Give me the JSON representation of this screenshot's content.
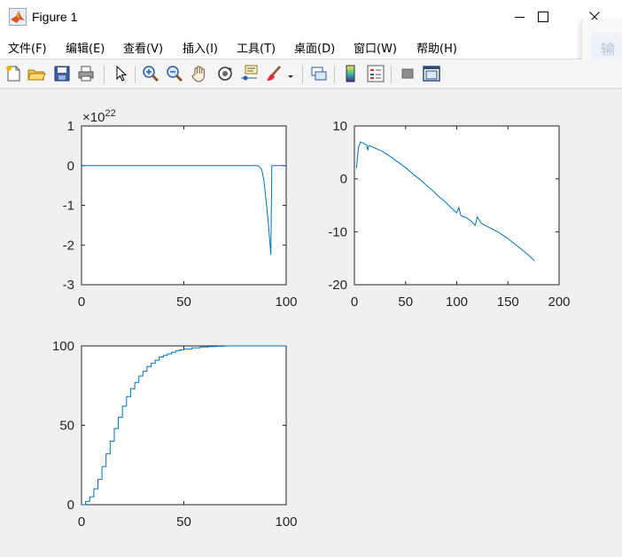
{
  "window": {
    "title": "Figure 1",
    "icon": "matlab-icon",
    "controls": [
      "minimize-icon",
      "maximize-icon",
      "close-icon"
    ]
  },
  "menu": [
    "文件(F)",
    "编辑(E)",
    "查看(V)",
    "插入(I)",
    "工具(T)",
    "桌面(D)",
    "窗口(W)",
    "帮助(H)"
  ],
  "toolbar": [
    "new-figure-icon",
    "open-file-icon",
    "save-icon",
    "print-icon",
    "select-arrow-icon",
    "zoom-in-icon",
    "zoom-out-icon",
    "pan-hand-icon",
    "rotate-3d-icon",
    "data-cursor-icon",
    "brush-icon",
    "brush-dropdown-icon",
    "link-plot-icon",
    "colorbar-icon",
    "legend-icon",
    "hide-plot-tools-icon",
    "show-plot-tools-icon"
  ],
  "ime": {
    "text": "输"
  },
  "colors": {
    "line": "#0072bd",
    "axes": "#262626",
    "figure": "#f0f0f0"
  },
  "chart_data": [
    {
      "type": "line",
      "title": "",
      "xlabel": "",
      "ylabel": "",
      "exponent_label": {
        "base": "×10",
        "power": "22"
      },
      "xlim": [
        0,
        100
      ],
      "ylim": [
        -3,
        1
      ],
      "xticks": [
        0,
        50,
        100
      ],
      "yticks": [
        1,
        0,
        -1,
        -2,
        -3
      ],
      "grid": false,
      "series": [
        {
          "x": [
            0,
            86,
            87,
            88,
            88.5,
            89,
            89.5,
            90,
            90.5,
            91,
            91.5,
            92,
            92.5,
            93,
            93.5,
            94,
            94.5,
            95,
            100
          ],
          "y": [
            0,
            0,
            -0.03,
            -0.1,
            -0.2,
            -0.35,
            -0.55,
            -0.8,
            -1.05,
            -1.3,
            -1.6,
            -1.9,
            -2.25,
            0,
            0,
            0,
            0,
            0,
            0
          ]
        }
      ]
    },
    {
      "type": "line",
      "title": "",
      "xlabel": "",
      "ylabel": "",
      "xlim": [
        0,
        200
      ],
      "ylim": [
        -20,
        10
      ],
      "xticks": [
        0,
        50,
        100,
        150,
        200
      ],
      "yticks": [
        10,
        0,
        -10,
        -20
      ],
      "grid": false,
      "series": [
        {
          "x": [
            2,
            4,
            6,
            8,
            10,
            12,
            13,
            14,
            16,
            18,
            20,
            24,
            28,
            32,
            36,
            40,
            44,
            48,
            52,
            56,
            60,
            64,
            68,
            72,
            76,
            80,
            84,
            88,
            92,
            96,
            100,
            102,
            104,
            106,
            110,
            114,
            118,
            120,
            124,
            130,
            140,
            150,
            160,
            170,
            176
          ],
          "y": [
            2,
            6,
            7,
            6.8,
            6.6,
            6.4,
            5.4,
            6.3,
            6.2,
            6.0,
            5.8,
            5.5,
            5.1,
            4.6,
            4.1,
            3.5,
            3.0,
            2.4,
            1.8,
            1.1,
            0.5,
            -0.1,
            -0.8,
            -1.5,
            -2.1,
            -2.9,
            -3.6,
            -4.2,
            -5.0,
            -5.7,
            -6.4,
            -5.4,
            -6.9,
            -7.1,
            -7.4,
            -8.0,
            -8.8,
            -7.2,
            -8.4,
            -9.0,
            -10.0,
            -11.3,
            -12.8,
            -14.4,
            -15.5
          ]
        }
      ]
    },
    {
      "type": "line",
      "title": "",
      "xlabel": "",
      "ylabel": "",
      "xlim": [
        0,
        100
      ],
      "ylim": [
        0,
        100
      ],
      "xticks": [
        0,
        50,
        100
      ],
      "yticks": [
        100,
        50,
        0
      ],
      "grid": false,
      "series": [
        {
          "x": [
            0,
            2,
            4,
            6,
            8,
            10,
            12,
            14,
            16,
            18,
            20,
            22,
            24,
            26,
            28,
            30,
            32,
            34,
            36,
            38,
            40,
            42,
            44,
            46,
            48,
            50,
            54,
            58,
            62,
            66,
            70,
            80,
            90,
            100
          ],
          "y": [
            0,
            2,
            5,
            10,
            16,
            24,
            32,
            40,
            48,
            55,
            62,
            68,
            73,
            77,
            81,
            84,
            87,
            89,
            91,
            93,
            94,
            95,
            96,
            97,
            97.5,
            98,
            98.8,
            99.3,
            99.6,
            99.8,
            100,
            100,
            100,
            100
          ]
        }
      ]
    }
  ]
}
